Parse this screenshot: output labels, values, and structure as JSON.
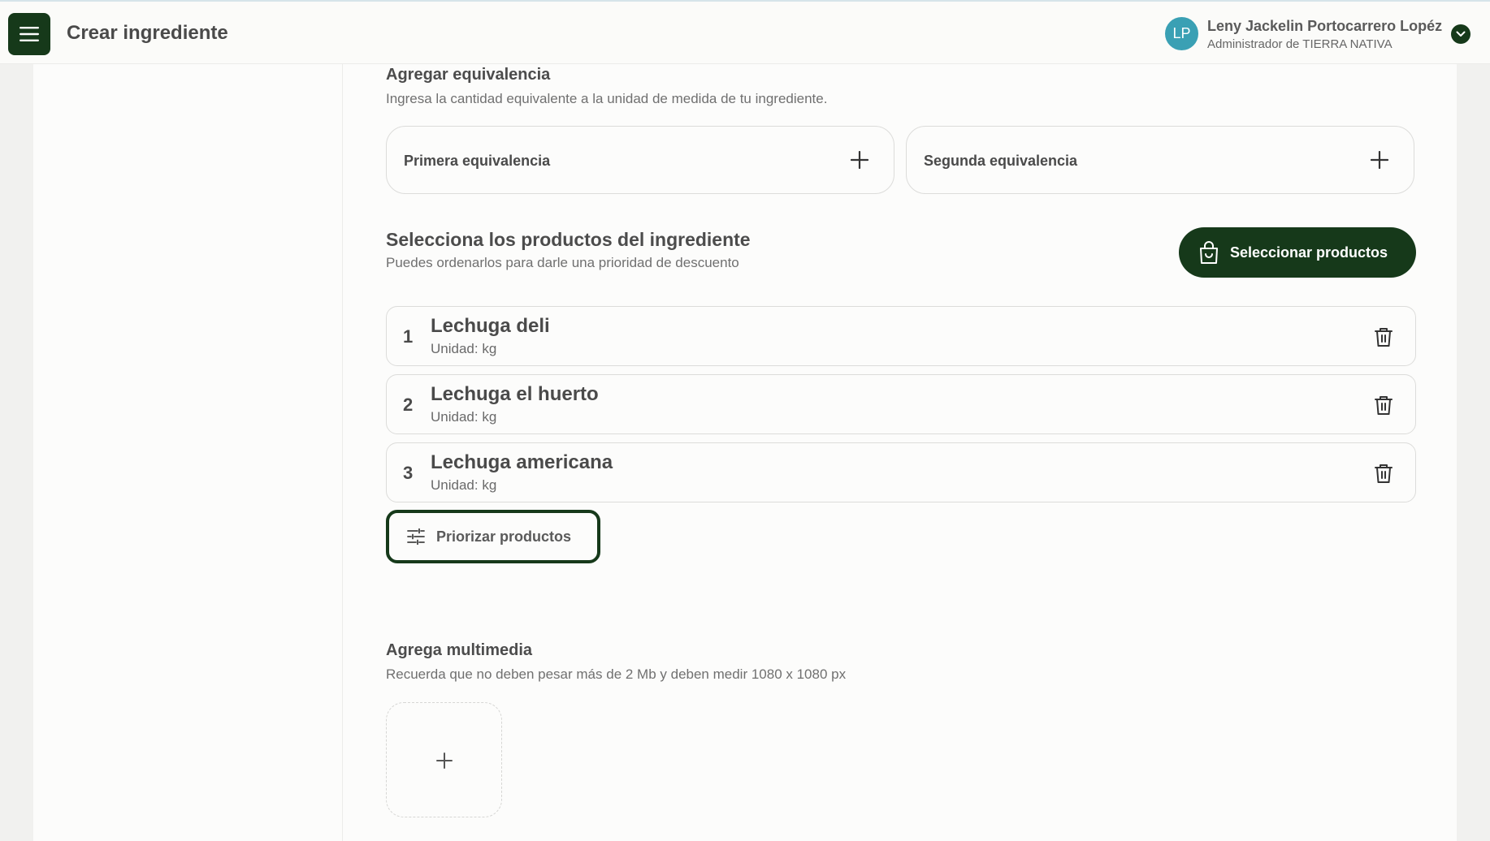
{
  "header": {
    "title": "Crear ingrediente",
    "user": {
      "initials": "LP",
      "name": "Leny Jackelin Portocarrero Lopéz",
      "role": "Administrador de TIERRA NATIVA"
    }
  },
  "equivalence": {
    "title": "Agregar equivalencia",
    "subtitle": "Ingresa la cantidad equivalente a la unidad de medida de tu ingrediente.",
    "cards": [
      {
        "label": "Primera equivalencia"
      },
      {
        "label": "Segunda equivalencia"
      }
    ]
  },
  "products": {
    "title": "Selecciona los productos del ingrediente",
    "subtitle": "Puedes ordenarlos para darle una prioridad de descuento",
    "select_button": "Seleccionar productos",
    "items": [
      {
        "num": "1",
        "name": "Lechuga deli",
        "unit": "Unidad: kg"
      },
      {
        "num": "2",
        "name": "Lechuga el huerto",
        "unit": "Unidad: kg"
      },
      {
        "num": "3",
        "name": "Lechuga americana",
        "unit": "Unidad: kg"
      }
    ],
    "prioritize_button": "Priorizar productos"
  },
  "multimedia": {
    "title": "Agrega multimedia",
    "subtitle": "Recuerda que no deben pesar más de 2 Mb y deben medir 1080 x 1080 px"
  },
  "colors": {
    "brand_dark_green": "#16391a",
    "avatar_teal": "#3aa0b4"
  },
  "icons": [
    "hamburger-menu-icon",
    "chevron-down-icon",
    "plus-icon",
    "shopping-bag-icon",
    "trash-icon",
    "sliders-icon"
  ]
}
